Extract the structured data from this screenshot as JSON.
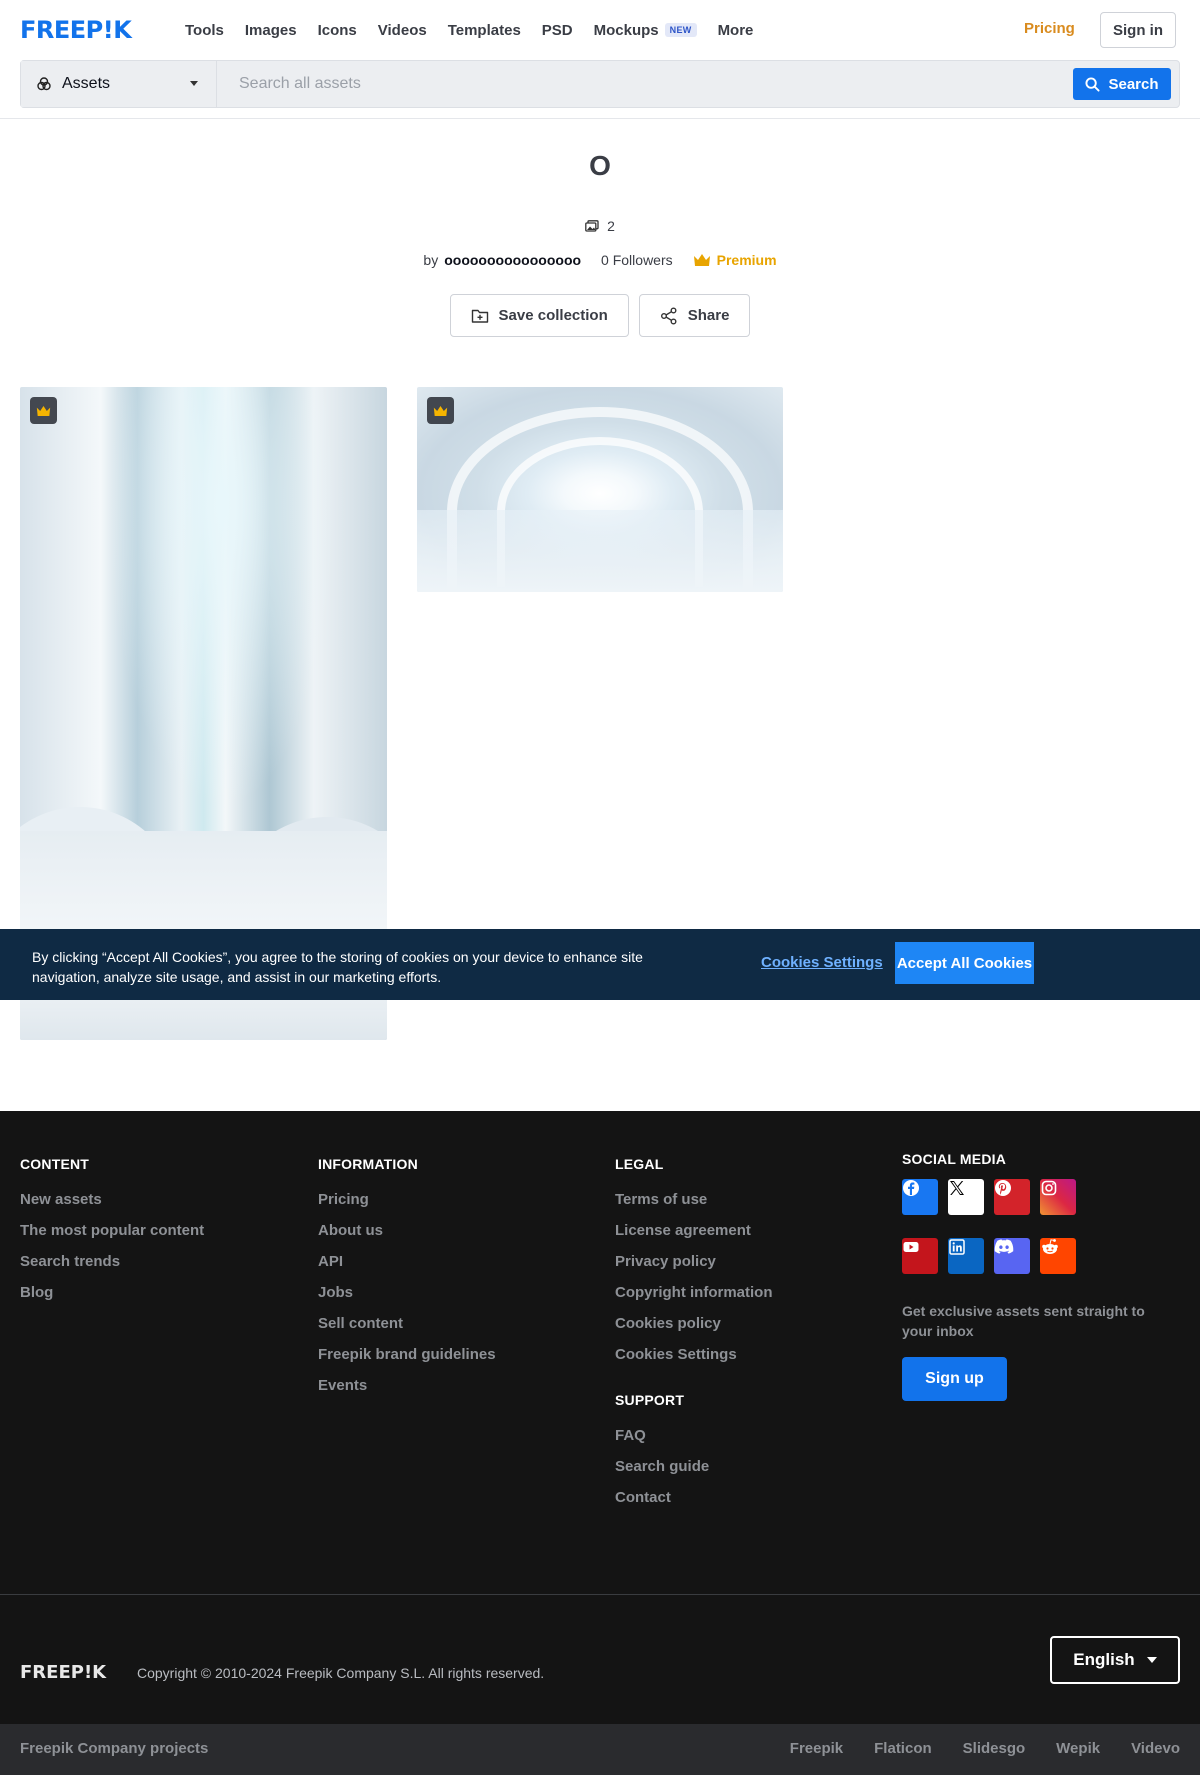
{
  "header": {
    "logo": "FREEP!K",
    "nav": [
      "Tools",
      "Images",
      "Icons",
      "Videos",
      "Templates",
      "PSD",
      "Mockups",
      "More"
    ],
    "mockups_badge": "NEW",
    "pricing": "Pricing",
    "sign_in": "Sign in"
  },
  "search": {
    "category": "Assets",
    "placeholder": "Search all assets",
    "button": "Search"
  },
  "collection": {
    "title": "O",
    "count": "2",
    "by": "by",
    "author": "oooooooooooooooo",
    "followers": "0 Followers",
    "premium": "Premium",
    "save_label": "Save collection",
    "share_label": "Share"
  },
  "cookie": {
    "text": "By clicking “Accept All Cookies”, you agree to the storing of cookies on your device to enhance site navigation, analyze site usage, and assist in our marketing efforts.",
    "settings": "Cookies Settings",
    "accept": "Accept All Cookies"
  },
  "footer": {
    "content": {
      "heading": "CONTENT",
      "links": [
        "New assets",
        "The most popular content",
        "Search trends",
        "Blog"
      ]
    },
    "information": {
      "heading": "INFORMATION",
      "links": [
        "Pricing",
        "About us",
        "API",
        "Jobs",
        "Sell content",
        "Freepik brand guidelines",
        "Events"
      ]
    },
    "legal": {
      "heading": "LEGAL",
      "links": [
        "Terms of use",
        "License agreement",
        "Privacy policy",
        "Copyright information",
        "Cookies policy",
        "Cookies Settings"
      ]
    },
    "support": {
      "heading": "SUPPORT",
      "links": [
        "FAQ",
        "Search guide",
        "Contact"
      ]
    },
    "social": {
      "heading": "SOCIAL MEDIA",
      "icons": [
        {
          "name": "facebook-icon",
          "color": "#1877f2"
        },
        {
          "name": "x-icon",
          "color": "#ffffff"
        },
        {
          "name": "pinterest-icon",
          "color": "#d3232a"
        },
        {
          "name": "instagram-icon",
          "color": "#c13584"
        },
        {
          "name": "youtube-icon",
          "color": "#c4151c"
        },
        {
          "name": "linkedin-icon",
          "color": "#0a66c2"
        },
        {
          "name": "discord-icon",
          "color": "#5865f2"
        },
        {
          "name": "reddit-icon",
          "color": "#ff4500"
        }
      ],
      "newsletter": "Get exclusive assets sent straight to your inbox",
      "signup": "Sign up"
    },
    "logo": "FREEP!K",
    "copyright": "Copyright © 2010-2024 Freepik Company S.L. All rights reserved.",
    "language": "English",
    "projects_label": "Freepik Company projects",
    "projects": [
      "Freepik",
      "Flaticon",
      "Slidesgo",
      "Wepik",
      "Videvo"
    ]
  },
  "colors": {
    "brand": "#1273eb",
    "pricing": "#d98b1e",
    "premium": "#e8a400",
    "cookie_bg": "#0f2a44",
    "footer_bg": "#141414"
  }
}
